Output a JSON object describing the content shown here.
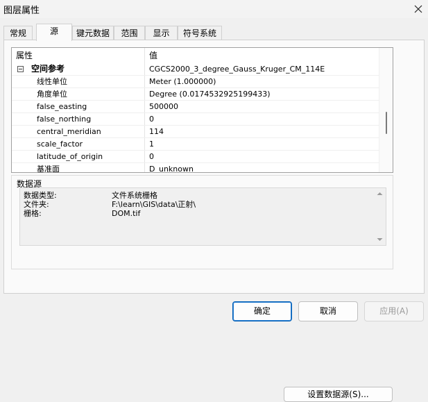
{
  "window": {
    "title": "图层属性"
  },
  "tabs": [
    {
      "label": "常规",
      "active": false
    },
    {
      "label": "源",
      "active": true
    },
    {
      "label": "键元数据",
      "active": false
    },
    {
      "label": "范围",
      "active": false
    },
    {
      "label": "显示",
      "active": false
    },
    {
      "label": "符号系统",
      "active": false
    }
  ],
  "properties": {
    "headers": {
      "name": "属性",
      "value": "值"
    },
    "rows": [
      {
        "name": "空间参考",
        "value": "CGCS2000_3_degree_Gauss_Kruger_CM_114E"
      },
      {
        "name": "线性单位",
        "value": "Meter (1.000000)"
      },
      {
        "name": "角度单位",
        "value": "Degree (0.0174532925199433)"
      },
      {
        "name": "false_easting",
        "value": "500000"
      },
      {
        "name": "false_northing",
        "value": "0"
      },
      {
        "name": "central_meridian",
        "value": "114"
      },
      {
        "name": "scale_factor",
        "value": "1"
      },
      {
        "name": "latitude_of_origin",
        "value": "0"
      },
      {
        "name": "基准面",
        "value": "D_unknown"
      }
    ]
  },
  "datasource": {
    "title": "数据源",
    "lines": [
      {
        "key": "数据类型:",
        "value": "文件系统栅格"
      },
      {
        "key": "文件夹:",
        "value": "F:\\learn\\GIS\\data\\正射\\"
      },
      {
        "key": "栅格:",
        "value": "DOM.tif"
      }
    ],
    "set_button": "设置数据源(S)..."
  },
  "buttons": {
    "ok": "确定",
    "cancel": "取消",
    "apply": "应用(A)"
  },
  "icons": {
    "close": "close-icon",
    "collapse": "collapse-icon",
    "scroll_up": "arrow-up-icon",
    "scroll_down": "arrow-down-icon"
  }
}
